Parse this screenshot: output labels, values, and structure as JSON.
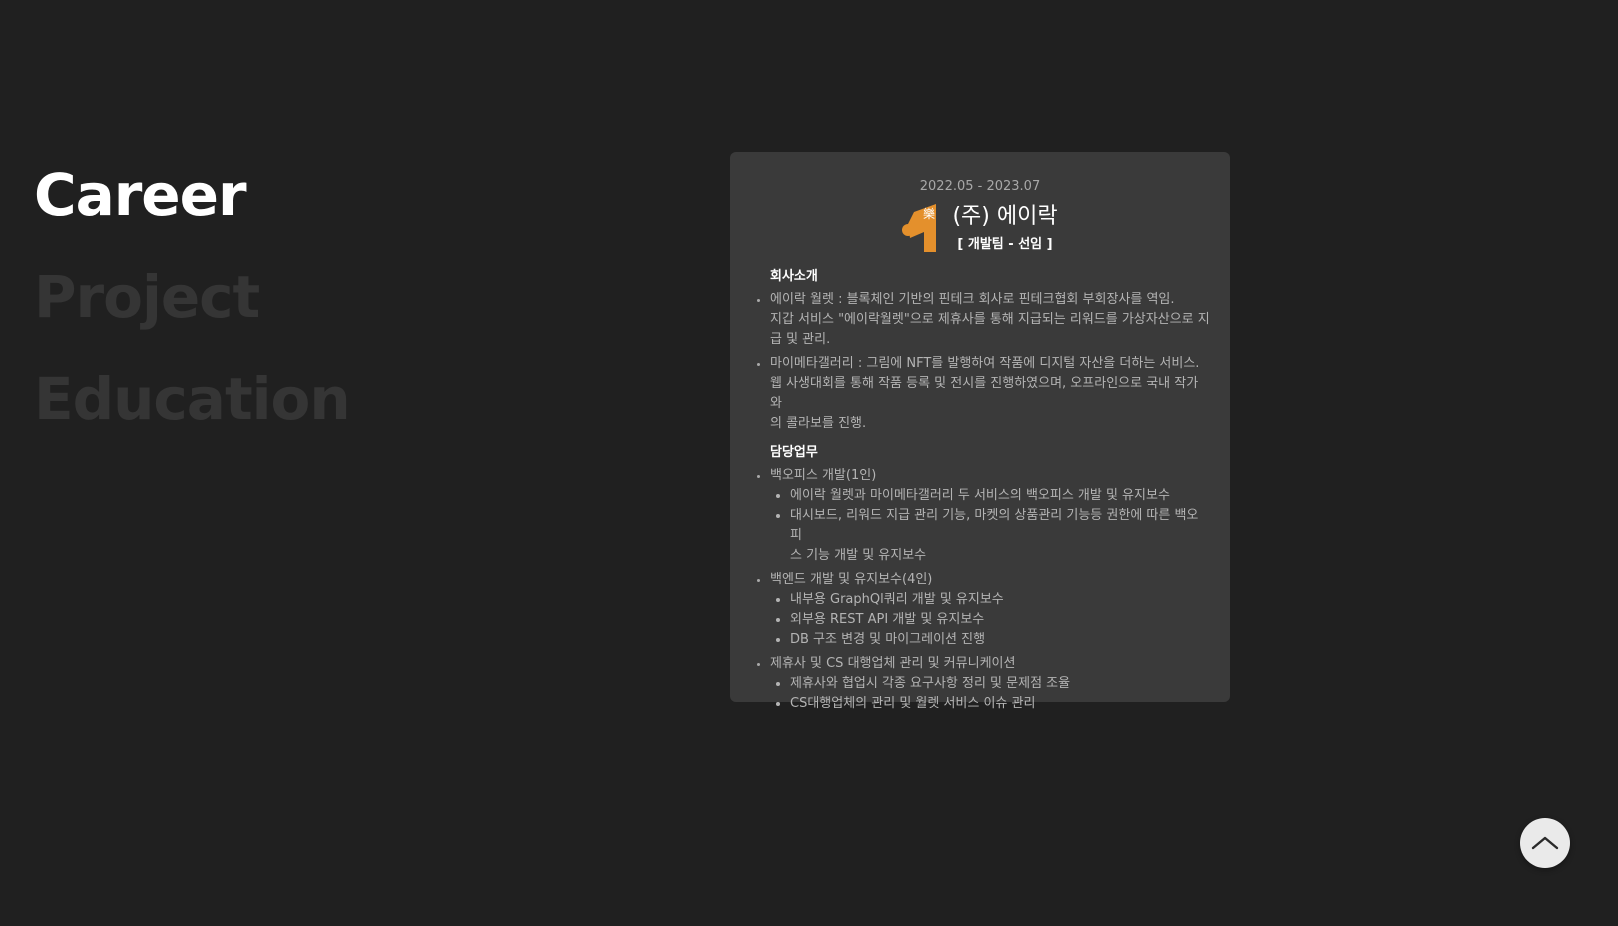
{
  "nav": {
    "items": [
      {
        "label": "Career",
        "state": "active"
      },
      {
        "label": "Project",
        "state": "inactive"
      },
      {
        "label": "Education",
        "state": "inactive"
      }
    ]
  },
  "career": {
    "period": "2022.05 - 2023.07",
    "company": "(주) 에이락",
    "role": "[ 개발팀 - 선임 ]",
    "logo": {
      "icon": "company-logo-icon",
      "text": "樂",
      "color": "#e4902c"
    },
    "intro_title": "회사소개",
    "intro": [
      {
        "lines": [
          "에이락 월렛 : 블록체인 기반의 핀테크 회사로 핀테크협회 부회장사를 역임.",
          "지갑 서비스 \"에이락월렛\"으로 제휴사를 통해 지급되는 리워드를 가상자산으로 지",
          "급 및 관리."
        ]
      },
      {
        "lines": [
          "마이메타갤러리 : 그림에 NFT를 발행하여 작품에 디지털 자산을 더하는 서비스.",
          "웹 사생대회를 통해 작품 등록 및 전시를 진행하였으며, 오프라인으로 국내 작가와",
          "의 콜라보를 진행."
        ]
      }
    ],
    "duty_title": "담당업무",
    "duties": [
      {
        "label": "백오피스 개발(1인)",
        "sub": [
          [
            "에이락 월렛과 마이메타갤러리 두 서비스의 백오피스 개발 및 유지보수"
          ],
          [
            "대시보드, 리워드 지급 관리 기능, 마켓의 상품관리 기능등 권한에 따른 백오피",
            "스 기능 개발 및 유지보수"
          ]
        ]
      },
      {
        "label": "백엔드 개발 및 유지보수(4인)",
        "sub": [
          [
            "내부용 GraphQl쿼리 개발 및 유지보수"
          ],
          [
            "외부용 REST API 개발 및 유지보수"
          ],
          [
            "DB 구조 변경 및 마이그레이션 진행"
          ]
        ]
      },
      {
        "label": "제휴사 및 CS 대행업체 관리 및 커뮤니케이션",
        "sub": [
          [
            "제휴사와 협업시 각종 요구사항 정리 및 문제점 조율"
          ],
          [
            "CS대행업체의 관리 및 월렛 서비스 이슈 관리"
          ]
        ]
      }
    ]
  },
  "scroll_top": {
    "icon": "chevron-up-icon"
  },
  "colors": {
    "background": "#202020",
    "card": "#3a3a3a",
    "active_nav": "#ffffff",
    "inactive_nav": "#353535",
    "logo": "#e4902c"
  }
}
